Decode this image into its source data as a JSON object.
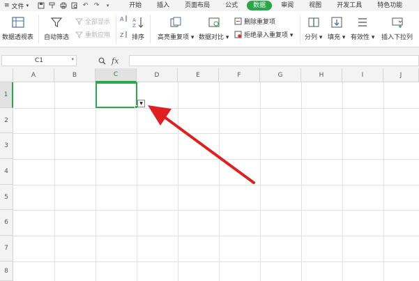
{
  "menubar": {
    "file_label": "文件",
    "tabs": [
      {
        "label": "开始"
      },
      {
        "label": "插入"
      },
      {
        "label": "页面布局"
      },
      {
        "label": "公式"
      },
      {
        "label": "数据",
        "active": true
      },
      {
        "label": "审阅"
      },
      {
        "label": "视图"
      },
      {
        "label": "开发工具"
      },
      {
        "label": "特色功能"
      }
    ],
    "quick_access_icons": [
      "save-icon",
      "format-painter-icon",
      "print-icon",
      "print-preview-icon",
      "undo-icon",
      "redo-icon"
    ]
  },
  "ribbon": {
    "pivot_table": "数据透视表",
    "auto_filter": "自动筛选",
    "show_all": "全部显示",
    "reapply": "重新应用",
    "sort": "排序",
    "highlight_duplicates": "高亮重复项",
    "data_compare": "数据对比",
    "remove_duplicates": "删除重复项",
    "reject_duplicates": "拒绝录入重复项",
    "split_column": "分列",
    "fill": "填充",
    "validation": "有效性",
    "insert_dropdown": "插入下拉列"
  },
  "formula_bar": {
    "name_box": "C1",
    "fx_label": "fx",
    "formula_value": ""
  },
  "grid": {
    "columns": [
      "A",
      "B",
      "C",
      "D",
      "E",
      "F",
      "G",
      "H",
      "I",
      "J"
    ],
    "rows": [
      "1",
      "2",
      "3",
      "4",
      "5",
      "6",
      "7",
      "8"
    ],
    "selected_column": "C",
    "selected_row": "1",
    "active_cell": "C1"
  },
  "colors": {
    "accent": "#2aa64b",
    "arrow": "#e02020"
  }
}
